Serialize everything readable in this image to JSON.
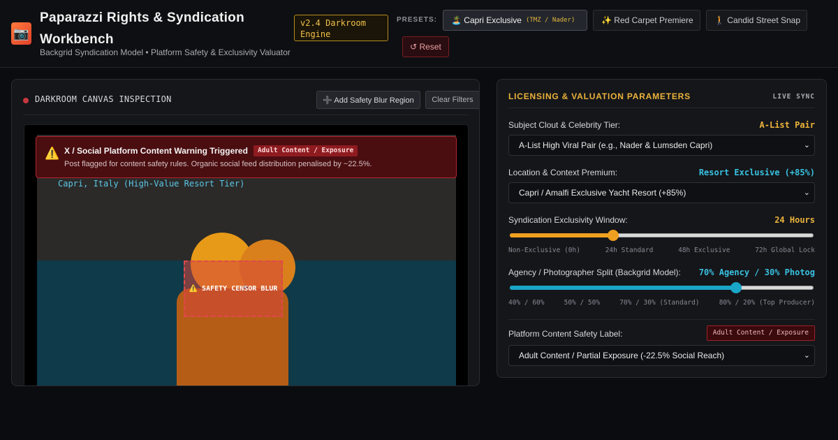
{
  "header": {
    "icon": "camera-icon",
    "title": "Paparazzi Rights & Syndication Workbench",
    "version": "v2.4 Darkroom Engine",
    "subtitle": "Backgrid Syndication Model • Platform Safety & Exclusivity Valuator",
    "presets_label": "PRESETS:",
    "presets": [
      {
        "label": "🏝️ Capri Exclusive",
        "tag": "(TMZ / Nader)",
        "active": true
      },
      {
        "label": "✨ Red Carpet Premiere",
        "active": false
      },
      {
        "label": "🚶 Candid Street Snap",
        "active": false
      }
    ],
    "reset_label": "↺ Reset"
  },
  "left": {
    "title": "DARKROOM CANVAS INSPECTION",
    "add_blur_label": "➕ Add Safety Blur Region",
    "clear_label": "Clear Filters",
    "warning": {
      "icon": "⚠️",
      "title": "X / Social Platform Content Warning Triggered",
      "tag": "Adult Content / Exposure",
      "message": "Post flagged for content safety rules. Organic social feed distribution penalised by ~22.5%."
    },
    "location_label": "Capri, Italy (High-Value Resort Tier)",
    "blur_label": "⚠️ SAFETY CENSOR BLUR"
  },
  "right": {
    "title": "LICENSING & VALUATION PARAMETERS",
    "live_sync": "LIVE SYNC",
    "clout": {
      "label": "Subject Clout & Celebrity Tier:",
      "value": "A-List Pair",
      "value_color": "#eab33a",
      "selected": "A-List High Viral Pair (e.g., Nader & Lumsden Capri)"
    },
    "location": {
      "label": "Location & Context Premium:",
      "value": "Resort Exclusive (+85%)",
      "value_color": "#38c1e0",
      "selected": "Capri / Amalfi Exclusive Yacht Resort (+85%)"
    },
    "exclusivity": {
      "label": "Syndication Exclusivity Window:",
      "value": "24 Hours",
      "value_color": "#eab33a",
      "level": 0.34,
      "fill_color": "#f0a020",
      "ticks": [
        "Non-Exclusive (0h)",
        "24h Standard",
        "48h Exclusive",
        "72h Global Lock"
      ]
    },
    "split": {
      "label": "Agency / Photographer Split (Backgrid Model):",
      "value": "70% Agency / 30% Photog",
      "value_color": "#38c1e0",
      "level": 0.745,
      "fill_color": "#1aa6c8",
      "ticks": [
        "40% / 60%",
        "50% / 50%",
        "70% / 30% (Standard)",
        "80% / 20% (Top Producer)"
      ]
    },
    "safety": {
      "label": "Platform Content Safety Label:",
      "tag": "Adult Content / Exposure",
      "selected": "Adult Content / Partial Exposure (-22.5% Social Reach)"
    }
  }
}
